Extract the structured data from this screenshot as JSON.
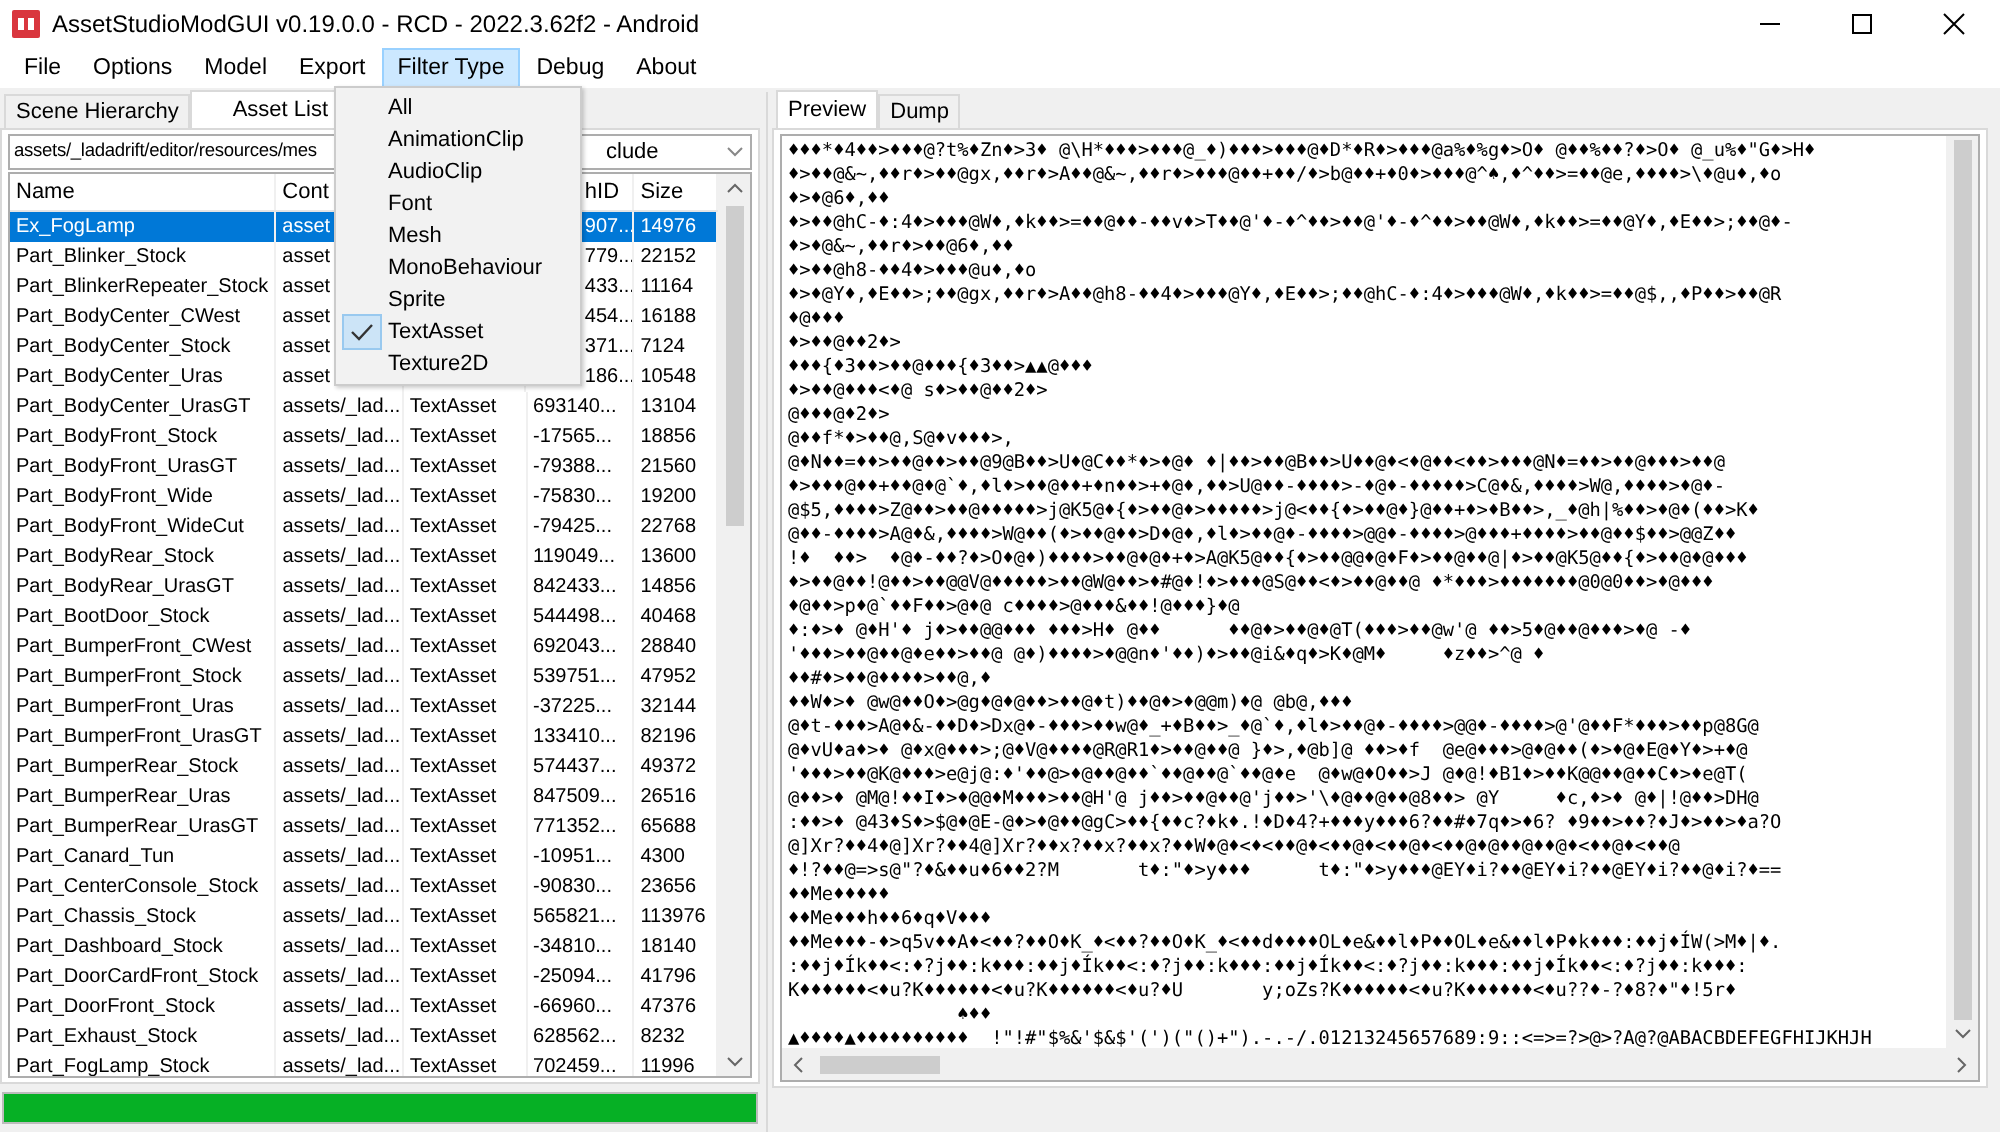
{
  "window": {
    "title": "AssetStudioModGUI v0.19.0.0 - RCD - 2022.3.62f2 - Android"
  },
  "menu": [
    {
      "label": "File",
      "selected": false
    },
    {
      "label": "Options",
      "selected": false
    },
    {
      "label": "Model",
      "selected": false
    },
    {
      "label": "Export",
      "selected": false
    },
    {
      "label": "Filter Type",
      "selected": true
    },
    {
      "label": "Debug",
      "selected": false
    },
    {
      "label": "About",
      "selected": false
    }
  ],
  "filter_menu": [
    {
      "label": "All",
      "checked": false
    },
    {
      "label": "AnimationClip",
      "checked": false
    },
    {
      "label": "AudioClip",
      "checked": false
    },
    {
      "label": "Font",
      "checked": false
    },
    {
      "label": "Mesh",
      "checked": false
    },
    {
      "label": "MonoBehaviour",
      "checked": false
    },
    {
      "label": "Sprite",
      "checked": false
    },
    {
      "label": "TextAsset",
      "checked": true
    },
    {
      "label": "Texture2D",
      "checked": false
    }
  ],
  "left_tabs": [
    {
      "label": "Scene Hierarchy",
      "selected": false
    },
    {
      "label": "Asset List",
      "selected": true
    }
  ],
  "path_filter": {
    "value": "assets/_ladadrift/editor/resources/mes"
  },
  "mode_filter": {
    "value": "clude"
  },
  "table": {
    "columns": {
      "name": "Name",
      "container": "Cont",
      "path_id": "hID",
      "size": "Size"
    },
    "rows": [
      {
        "name": "Ex_FogLamp",
        "container": "asset",
        "path_id": "907...",
        "size": "14976",
        "selected": true
      },
      {
        "name": "Part_Blinker_Stock",
        "container": "asset",
        "path_id": "779...",
        "size": "22152",
        "selected": false
      },
      {
        "name": "Part_BlinkerRepeater_Stock",
        "container": "asset",
        "path_id": "433...",
        "size": "11164",
        "selected": false
      },
      {
        "name": "Part_BodyCenter_CWest",
        "container": "asset",
        "path_id": "454...",
        "size": "16188",
        "selected": false
      },
      {
        "name": "Part_BodyCenter_Stock",
        "container": "asset",
        "path_id": "371...",
        "size": "7124",
        "selected": false
      },
      {
        "name": "Part_BodyCenter_Uras",
        "container": "asset",
        "path_id": "186...",
        "size": "10548",
        "selected": false
      },
      {
        "name": "Part_BodyCenter_UrasGT",
        "container": "assets/_lad...",
        "type": "TextAsset",
        "path_id": "693140...",
        "size": "13104",
        "selected": false
      },
      {
        "name": "Part_BodyFront_Stock",
        "container": "assets/_lad...",
        "type": "TextAsset",
        "path_id": "-17565...",
        "size": "18856",
        "selected": false
      },
      {
        "name": "Part_BodyFront_UrasGT",
        "container": "assets/_lad...",
        "type": "TextAsset",
        "path_id": "-79388...",
        "size": "21560",
        "selected": false
      },
      {
        "name": "Part_BodyFront_Wide",
        "container": "assets/_lad...",
        "type": "TextAsset",
        "path_id": "-75830...",
        "size": "19200",
        "selected": false
      },
      {
        "name": "Part_BodyFront_WideCut",
        "container": "assets/_lad...",
        "type": "TextAsset",
        "path_id": "-79425...",
        "size": "22768",
        "selected": false
      },
      {
        "name": "Part_BodyRear_Stock",
        "container": "assets/_lad...",
        "type": "TextAsset",
        "path_id": "119049...",
        "size": "13600",
        "selected": false
      },
      {
        "name": "Part_BodyRear_UrasGT",
        "container": "assets/_lad...",
        "type": "TextAsset",
        "path_id": "842433...",
        "size": "14856",
        "selected": false
      },
      {
        "name": "Part_BootDoor_Stock",
        "container": "assets/_lad...",
        "type": "TextAsset",
        "path_id": "544498...",
        "size": "40468",
        "selected": false
      },
      {
        "name": "Part_BumperFront_CWest",
        "container": "assets/_lad...",
        "type": "TextAsset",
        "path_id": "692043...",
        "size": "28840",
        "selected": false
      },
      {
        "name": "Part_BumperFront_Stock",
        "container": "assets/_lad...",
        "type": "TextAsset",
        "path_id": "539751...",
        "size": "47952",
        "selected": false
      },
      {
        "name": "Part_BumperFront_Uras",
        "container": "assets/_lad...",
        "type": "TextAsset",
        "path_id": "-37225...",
        "size": "32144",
        "selected": false
      },
      {
        "name": "Part_BumperFront_UrasGT",
        "container": "assets/_lad...",
        "type": "TextAsset",
        "path_id": "133410...",
        "size": "82196",
        "selected": false
      },
      {
        "name": "Part_BumperRear_Stock",
        "container": "assets/_lad...",
        "type": "TextAsset",
        "path_id": "574437...",
        "size": "49372",
        "selected": false
      },
      {
        "name": "Part_BumperRear_Uras",
        "container": "assets/_lad...",
        "type": "TextAsset",
        "path_id": "847509...",
        "size": "26516",
        "selected": false
      },
      {
        "name": "Part_BumperRear_UrasGT",
        "container": "assets/_lad...",
        "type": "TextAsset",
        "path_id": "771352...",
        "size": "65688",
        "selected": false
      },
      {
        "name": "Part_Canard_Tun",
        "container": "assets/_lad...",
        "type": "TextAsset",
        "path_id": "-10951...",
        "size": "4300",
        "selected": false
      },
      {
        "name": "Part_CenterConsole_Stock",
        "container": "assets/_lad...",
        "type": "TextAsset",
        "path_id": "-90830...",
        "size": "23656",
        "selected": false
      },
      {
        "name": "Part_Chassis_Stock",
        "container": "assets/_lad...",
        "type": "TextAsset",
        "path_id": "565821...",
        "size": "113976",
        "selected": false
      },
      {
        "name": "Part_Dashboard_Stock",
        "container": "assets/_lad...",
        "type": "TextAsset",
        "path_id": "-34810...",
        "size": "18140",
        "selected": false
      },
      {
        "name": "Part_DoorCardFront_Stock",
        "container": "assets/_lad...",
        "type": "TextAsset",
        "path_id": "-25094...",
        "size": "41796",
        "selected": false
      },
      {
        "name": "Part_DoorFront_Stock",
        "container": "assets/_lad...",
        "type": "TextAsset",
        "path_id": "-66960...",
        "size": "47376",
        "selected": false
      },
      {
        "name": "Part_Exhaust_Stock",
        "container": "assets/_lad...",
        "type": "TextAsset",
        "path_id": "628562...",
        "size": "8232",
        "selected": false
      },
      {
        "name": "Part_FogLamp_Stock",
        "container": "assets/_lad...",
        "type": "TextAsset",
        "path_id": "702459...",
        "size": "11996",
        "selected": false
      }
    ]
  },
  "progress": {
    "level": 1
  },
  "right_tabs": [
    {
      "label": "Preview",
      "selected": true
    },
    {
      "label": "Dump",
      "selected": false
    }
  ],
  "preview_lines": [
    "♦♦♦*♦4♦♦>♦♦♦@?t%♦Zn♦>3♦ @\\H*♦♦♦>♦♦♦@_♦)♦♦♦>♦♦♦@♦D*♦R♦>♦♦♦@a%♦%g♦>O♦ @♦♦%♦♦?♦>O♦ @_u%♦\"G♦>H♦",
    "♦>♦♦@&~,♦♦r♦>♦♦@gx,♦♦r♦>A♦♦@&~,♦♦r♦>♦♦♦@♦♦+♦♦/♦>b@♦♦+♦0♦>♦♦♦@^♠,♦^♦♦>=♦♦@e,♦♦♦♦>\\♦@u♦,♦o",
    "♦>♦@6♦,♦♦",
    "♦>♦♦@hC-♦:4♦>♦♦♦@W♦,♦k♦♦>=♦♦@♦♦-♦♦v♦>T♦♦@'♦-♦^♦♦>♦♦@'♦-♦^♦♦>♦♦@W♦,♦k♦♦>=♦♦@Y♦,♦E♦♦>;♦♦@♦-",
    "♦>♦@&~,♦♦r♦>♦♦@6♦,♦♦",
    "♦>♦♦@h8-♦♦4♦>♦♦♦@u♦,♦o",
    "♦>♦@Y♦,♦E♦♦>;♦♦@gx,♦♦r♦>A♦♦@h8-♦♦4♦>♦♦♦@Y♦,♦E♦♦>;♦♦@hC-♦:4♦>♦♦♦@W♦,♦k♦♦>=♦♦@$,,♦P♦♦>♦♦@R",
    "♦@♦♦♦",
    "♦>♦♦@♦♦2♦>",
    "♦♦♦{♦3♦♦>♦♦@♦♦♦{♦3♦♦>▲▲@♦♦♦",
    "♦>♦♦@♦♦♦<♦@ s♦>♦♦@♦♦2♦>",
    "@♦♦♦@♦2♦>",
    "@♦♦f*♦>♦♦@,S@♦v♦♦♦>,",
    "@♦N♦♦=♦♦>♦♦@♦♦>♦♦@9@B♦♦>U♦@C♦♦*♦>♦@♦ ♦|♦♦>♦♦@B♦♦>U♦♦@♦<♦@♦♦<♦♦>♦♦♦@N♦=♦♦>♦♦@♦♦♦>♦♦@",
    "♦>♦♦♦@♦♦+♦♦@♦@`♦,♦l♦>♦♦@♦♦+♦n♦♦>+♦@♦,♦♦>U@♦♦-♦♦♦♦>-♦@♦-♦♦♦♦♦>C@♦&,♦♦♦♦>W@,♦♦♦♦>♦@♦-",
    "@$5,♦♦♦♦>Z@♦♦>♦♦@♦♦♦♦♦>j@K5@♦{♦>♦♦@♦>♦♦♦♦♦>j@<♦♦{♦>♦♦@♦}@♦♦+♦>♦B♦♦>,_♦@h|%♦♦>♦@♦(♦♦>K♦",
    "@♦♦-♦♦♦♦>A@♦&,♦♦♦♦>W@♦♦(♦>♦♦@♦♦>D♦@♦,♦l♦>♦♦@♦-♦♦♦♦>@@♦-♦♦♦♦>@♦♦♦+♦♦♦♦>♦♦@♦♦$♦♦>@@Z♦♦",
    "!♦  ♦♦>  ♦@♦-♦♦?♦>O♦@♦)♦♦♦♦>♦♦@♦@♦+♦>A@K5@♦♦{♦>♦♦@@♦@♦F♦>♦♦@♦♦@|♦>♦♦@K5@♦♦{♦>♦♦@♦@♦♦♦",
    "♦>♦♦@♦♦!@♦♦>♦♦@@V@♦♦♦♦♦>♦♦@W@♦♦>♦#@♦!♦>♦♦♦@S@♦♦<♦>♦♦@♦♦@ ♦*♦♦♦>♦♦♦♦♦♦♦@0@0♦♦>♦@♦♦♦",
    "♦@♦♦>p♦@`♦♦F♦♦>@♦@ c♦♦♦♦>@♦♦♦&♦♦!@♦♦♦}♦@",
    "♦:♦>♦ @♦H'♦ j♦>♦♦@@♦♦♦ ♦♦♦>H♦ @♦♦      ♦♦@♦>♦♦@♦@T(♦♦♦>♦♦@w'@ ♦♦>5♦@♦♦@♦♦♦>♦@ -♦",
    "'♦♦♦>♦♦@♦♦@♦e♦♦>♦♦@ @♦)♦♦♦♦>♦@@n♦'♦♦)♦>♦♦@i&♦q♦>K♦@M♦     ♦z♦♦>^@ ♦",
    "♦♦#♦>♦♦@♦♦♦♦>♦♦@,♦",
    "♦♦W♦>♦ @w@♦♦O♦>@g♦@♦@♦♦>♦♦@♦t)♦♦@♦>♦@@m)♦@ @b@,♦♦♦",
    "@♦t-♦♦♦>A@♦&-♦♦D♦>Dx@♦-♦♦♦>♦♦w@♦_+♦B♦♦>_♦@`♦,♦l♦>♦♦@♦-♦♦♦♦>@@♦-♦♦♦♦>@'@♦♦F*♦♦♦>♦♦p@8G@",
    "@♦vU♦a♦>♦ @♦x@♦♦♦>;@♦V@♦♦♦♦@R@R1♦>♦♦@♦♦@ }♦>,♦@b]@ ♦♦>♦f  @e@♦♦♦>@♦@♦♦(♦>♦@♦E@♦Y♦>+♦@",
    "'♦♦♦>♦♦@K@♦♦♦>e@j@:♦'♦♦@>♦@♦♦@♦♦`♦♦@♦♦@`♦♦@♦e  @♦w@♦O♦♦>J @♦@!♦B1♦>♦♦K@@♦♦@♦♦C♦>♦e@T(",
    "@♦♦>♦ @M@!♦♦I♦>♦@@♦M♦♦♦>♦♦@H'@ j♦♦>♦♦@♦♦@'j♦♦>'\\♦@♦♦@♦♦@8♦♦> @Y     ♦c,♦>♦ @♦|!@♦♦>DH@",
    ":♦♦>♦ @43♦S♦>$@♦@E-@♦>♦@♦♦@gC>♦♦{♦♦c?♦k♦.!♦D♦4?+♦♦♦y♦♦♦6?♦♦#♦7q♦>♦6? ♦9♦♦>♦♦?♦J♦>♦♦>♦a?O",
    "@]Xr?♦♦4♦@]Xr?♦♦4@]Xr?♦♦x?♦♦x?♦♦x?♦♦W♦@♦<♦<♦♦@♦<♦♦@♦<♦♦@♦<♦♦@♦@♦♦@♦♦@♦<♦♦@♦<♦♦@",
    "♦!?♦♦@=>s@\"?♦&♦♦u♦6♦♦2?M       t♦:\"♦>y♦♦♦      t♦:\"♦>y♦♦♦@EY♦i?♦♦@EY♦i?♦♦@EY♦i?♦♦@♦i?♦==",
    "♦♦Me♦♦♦♦♦",
    "♦♦Me♦♦♦h♦♦6♦q♦V♦♦♦",
    "♦♦Me♦♦♦-♦>q5v♦♦A♦<♦♦?♦♦O♦K_♦<♦♦?♦♦O♦K_♦<♦♦d♦♦♦♦OL♦e&♦♦l♦P♦♦OL♦e&♦♦l♦P♦k♦♦♦:♦♦j♦ÍW(>M♦|♦.",
    ":♦♦j♦Ík♦♦<:♦?j♦♦:k♦♦♦:♦♦j♦Ík♦♦<:♦?j♦♦:k♦♦♦:♦♦j♦Ík♦♦<:♦?j♦♦:k♦♦♦:♦♦j♦Ík♦♦<:♦?j♦♦:k♦♦♦:",
    "K♦♦♦♦♦♦<♦u?K♦♦♦♦♦♦<♦u?K♦♦♦♦♦♦<♦u?♦U       y;oZs?K♦♦♦♦♦♦<♦u?K♦♦♦♦♦♦<♦u??♦-?♦8?♦\"♦!5r♦",
    "               ♠♦♦",
    "▲♦♦♦♦▲♦♦♦♦♦♦♦♦♦♦  !\"!#\"$%&'$&$'(')(\"()+\").-.-/.01213245657689:9::<=>=?>@>?A@?@ABACBDEFEGFHIJKHJH"
  ]
}
